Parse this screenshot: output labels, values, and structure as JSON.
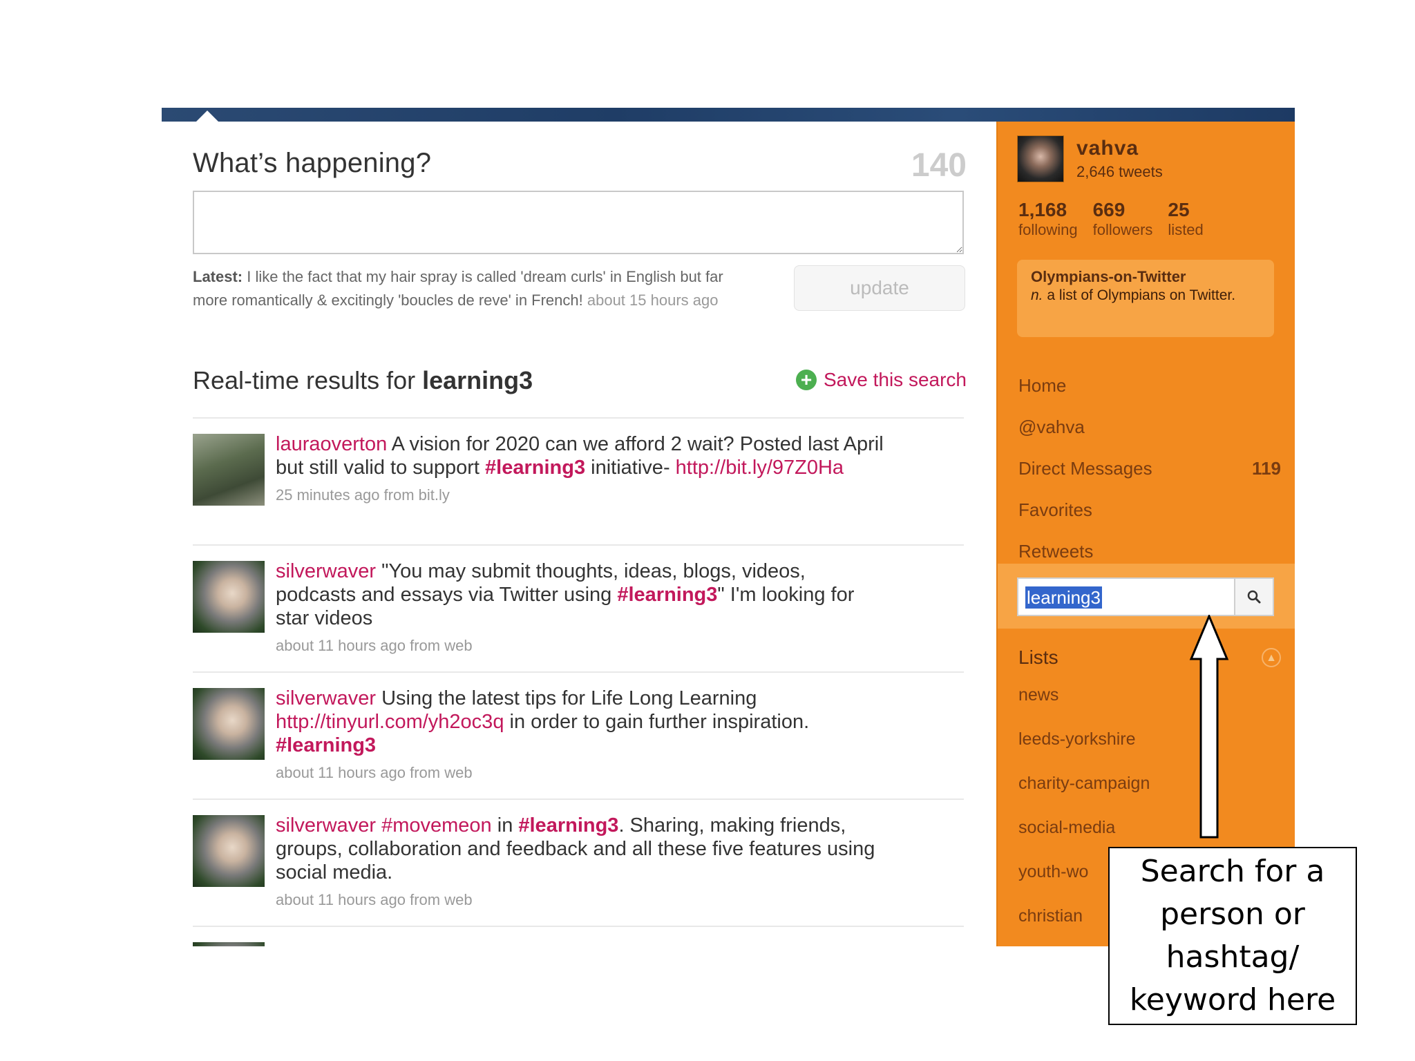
{
  "composer": {
    "title": "What’s happening?",
    "char_count": "140",
    "placeholder": "",
    "latest_label": "Latest:",
    "latest_text": " I like the fact that my hair spray is called 'dream curls' in English but far more romantically & excitingly 'boucles de reve' in French!",
    "latest_time": " about 15 hours ago",
    "update_label": "update"
  },
  "search_results": {
    "heading_prefix": "Real-time results for ",
    "query": "learning3",
    "save_label": "Save this search",
    "items": [
      {
        "user": "lauraoverton",
        "t1": " A vision for 2020 can we afford 2 wait? Posted last April but still valid to support ",
        "tag1": "#learning3",
        "t2": " initiative- ",
        "link": "http://bit.ly/97Z0Ha",
        "meta": "25 minutes ago from bit.ly"
      },
      {
        "user": "silverwaver",
        "t1": " \"You may submit thoughts, ideas, blogs, videos, podcasts and essays via Twitter using ",
        "tag1": "#learning3",
        "t2": "\" I'm looking for star videos",
        "meta": "about 11 hours ago from web"
      },
      {
        "user": "silverwaver",
        "t1": " Using the latest tips for Life Long Learning ",
        "link": "http://tinyurl.com/yh2oc3q",
        "t2": " in order to gain further inspiration. ",
        "tag1": "#learning3",
        "meta": "about 11 hours ago from web"
      },
      {
        "user": "silverwaver",
        "link": "#movemeon",
        "t1": " in ",
        "tag1": "#learning3",
        "t2": ". Sharing, making friends, groups, collaboration and feedback and all these five features using social media.",
        "meta": "about 11 hours ago from web"
      }
    ]
  },
  "profile": {
    "name": "vahva",
    "tweets": "2,646 tweets",
    "following_count": "1,168",
    "following_label": "following",
    "followers_count": "669",
    "followers_label": "followers",
    "listed_count": "25",
    "listed_label": "listed"
  },
  "list_card": {
    "title": "Olympians-on-Twitter",
    "desc_abbr": "n.",
    "desc": " a list of Olympians on Twitter."
  },
  "nav": {
    "home": "Home",
    "mentions": "@vahva",
    "dm": "Direct Messages",
    "dm_count": "119",
    "favorites": "Favorites",
    "retweets": "Retweets"
  },
  "search": {
    "value": "learning3"
  },
  "lists": {
    "title": "Lists",
    "items": [
      "news",
      "leeds-yorkshire",
      "charity-campaign",
      "social-media",
      "youth-wo",
      "christian"
    ]
  },
  "callout": {
    "text": "Search for a person or hashtag/ keyword here"
  },
  "colors": {
    "sidebar": "#f28a1f",
    "link": "#c2185b",
    "topbar": "#1f3d66"
  }
}
